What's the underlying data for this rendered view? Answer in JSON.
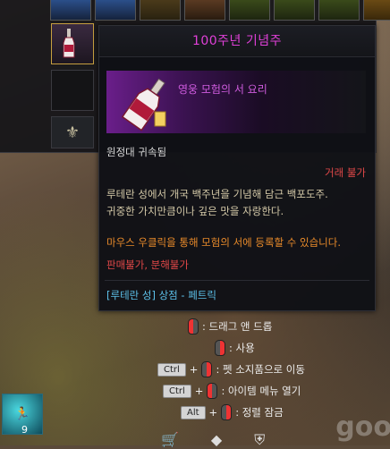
{
  "tooltip": {
    "title": "100주년 기념주",
    "subtitle": "영웅 모험의 서 요리",
    "bound": "원정대 귀속됨",
    "trade": "거래 불가",
    "description": [
      "루테란 성에서 개국 백주년을 기념해 담근 백포도주.",
      "귀중한 가치만큼이나 깊은 맛을 자랑한다."
    ],
    "use_hint": "마우스 우클릭을 통해 모험의 서에 등록할 수 있습니다.",
    "flags": "판매불가, 분해불가",
    "shop": "[루테란 성] 상점 - 페트릭"
  },
  "hints": {
    "drag": ": 드래그 앤 드롭",
    "use": ": 사용",
    "pet": ": 펫 소지품으로 이동",
    "menu": ": 아이템 메뉴 열기",
    "lock": ": 정렬 잠금",
    "key_ctrl": "Ctrl",
    "key_alt": "Alt",
    "plus": "+"
  },
  "skill": {
    "count": "9"
  },
  "watermark": "goo",
  "colors": {
    "title": "#e040d8",
    "subtitle": "#cf5cde",
    "trade": "#e24848",
    "use_hint": "#e88a2a",
    "shop": "#5cc0e8"
  }
}
